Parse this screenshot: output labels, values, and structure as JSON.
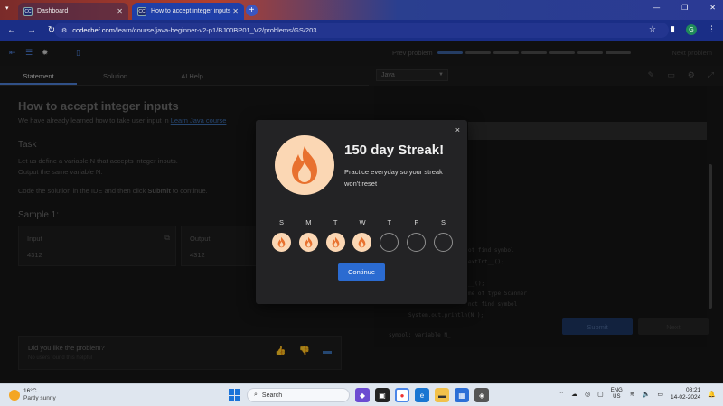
{
  "browser": {
    "tabs": [
      {
        "label": "Dashboard",
        "icon": "CC"
      },
      {
        "label": "How to accept integer inputs P",
        "icon": "CC"
      }
    ],
    "new_tab": "+",
    "url_host": "codechef.com",
    "url_path": "/learn/course/java-beginner-v2-p1/BJ00BP01_V2/problems/GS/203",
    "profile_initial": "G"
  },
  "toolbar": {
    "prev_problem": "Prev problem",
    "next_problem": "Next problem",
    "progress": {
      "done": 1,
      "total": 7
    }
  },
  "left_tabs": [
    "Statement",
    "Solution",
    "AI Help"
  ],
  "problem": {
    "title": "How to accept integer inputs",
    "subtitle_prefix": "We have already learned how to take user input in ",
    "subtitle_link": "Learn Java course",
    "task_label": "Task",
    "task_line1": "Let us define a variable N that accepts integer inputs.",
    "task_line2": "Output the same variable N.",
    "task_line3_prefix": "Code the solution in the IDE and then click ",
    "task_line3_bold": "Submit",
    "task_line3_suffix": " to continue.",
    "sample_label": "Sample 1:",
    "input_label": "Input",
    "input_value": "4312",
    "output_label": "Output",
    "output_value": "4312"
  },
  "feedback": {
    "question": "Did you like the problem?",
    "sub": "No users found this helpful"
  },
  "editor": {
    "language": "Java",
    "code_lines": [
      "ot find symbol",
      "extInt__();",
      "__();",
      "me of type Scanner",
      "not find symbol",
      "System.out.println(N_);",
      "symbol:   variable N_"
    ],
    "submit_label": "Submit",
    "next_label": "Next"
  },
  "modal": {
    "title": "150 day Streak!",
    "description": "Practice everyday so your streak won't reset",
    "close": "×",
    "days": [
      {
        "label": "S",
        "done": true
      },
      {
        "label": "M",
        "done": true
      },
      {
        "label": "T",
        "done": true
      },
      {
        "label": "W",
        "done": true
      },
      {
        "label": "T",
        "done": false
      },
      {
        "label": "F",
        "done": false
      },
      {
        "label": "S",
        "done": false
      }
    ],
    "button": "Continue",
    "accent": "#fbd7b4",
    "flame_color": "#e8712f"
  },
  "taskbar": {
    "temp": "16°C",
    "weather": "Partly sunny",
    "search_placeholder": "Search",
    "lang_line1": "ENG",
    "lang_line2": "US",
    "time": "08:21",
    "date": "14-02-2024"
  }
}
